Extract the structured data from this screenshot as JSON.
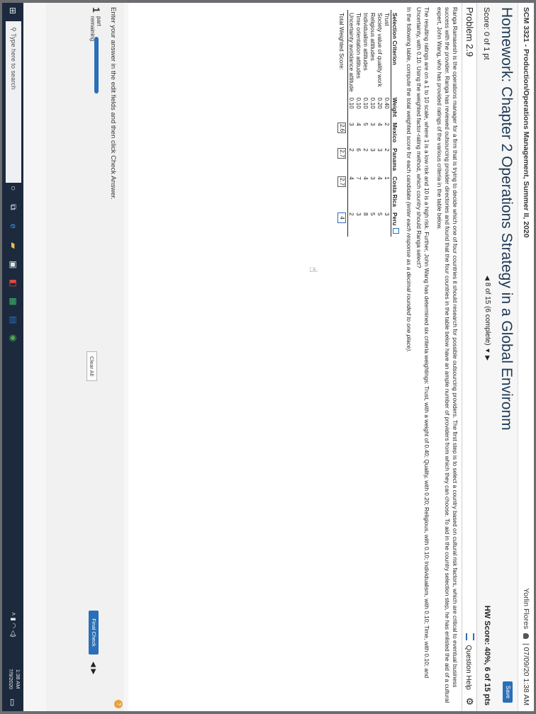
{
  "header": {
    "course": "SCM 3321 - Production/Operations Management, Summer II, 2020",
    "user": "Yorlin Flores",
    "separator": "|",
    "datetime": "07/09/20 1:38 AM"
  },
  "homework": {
    "title": "Homework: Chapter 2 Operations Strategy in a Global Environm",
    "save_label": "Save",
    "score": "Score: 0 of 1 pt",
    "nav_text": "8 of 15 (6 complete)",
    "hw_score": "HW Score: 40%, 6 of 15 pts"
  },
  "problem": {
    "number": "Problem 2.9",
    "help_label": "Question Help",
    "paragraph1": "Ranga Ramasesh is the operations manager for a firm that is trying to decide which one of four countries it should research for possible outsourcing providers. The first step is to select a country based on cultural risk factors, which are critical to eventual business success with the provider. Ranga has reviewed outsourcing provider directories and found that the four countries in the table below have an ample number of providers from which they can choose. To aid in the country selection step, he has enlisted the aid of a cultural expert, John Wang, who has provided ratings of the various criteria in the table below.",
    "paragraph2": "The resulting ratings are on a 1 to 10 scale, where 1 is a low risk and 10 is a high risk. Further, John Wang has determined six criteria weightings: Trust, with a weight of 0.40; Quality, with 0.20; Religious, with 0.10; Individualism, with 0.10; Time, with 0.10; and Uncertainty, with 0.10. Using the weighted factor-rating method, which country should Ranga select?",
    "paragraph3_main": "In the following table, compute the total weighted score for each candidate ",
    "paragraph3_italic": "(enter each response as a decimal rounded to one place)."
  },
  "table": {
    "headers": [
      "Selection Criterion",
      "Weight",
      "Mexico",
      "Panama",
      "Costa Rica",
      "Peru"
    ],
    "rows": [
      [
        "Trust",
        "0.40",
        "2",
        "2",
        "1",
        "3"
      ],
      [
        "Society value of quality work",
        "0.20",
        "4",
        "3",
        "4",
        "5"
      ],
      [
        "Religious attitudes",
        "0.10",
        "3",
        "3",
        "3",
        "5"
      ],
      [
        "Individualism attitudes",
        "0.10",
        "5",
        "2",
        "4",
        "8"
      ],
      [
        "Time orientation attitudes",
        "0.10",
        "4",
        "6",
        "7",
        "3"
      ],
      [
        "Uncertainty avoidance attitude",
        "0.10",
        "3",
        "2",
        "4",
        "2"
      ]
    ],
    "total_label": "Total Weighted Score:",
    "totals": [
      "2.6",
      "2.7",
      "2.7",
      "4"
    ]
  },
  "footer": {
    "instruction": "Enter your answer in the edit fields and then click Check Answer.",
    "part_number": "1",
    "part_label_1": "part",
    "part_label_2": "remaining",
    "clear_all": "Clear All",
    "final_check": "Final Check",
    "help_icon": "?"
  },
  "taskbar": {
    "search_placeholder": "Type here to search",
    "time": "1:38 AM",
    "date": "7/9/2020"
  },
  "colors": {
    "accent": "#2a6fb8",
    "title": "#1f3a56",
    "taskbar": "#1d2a3d"
  }
}
